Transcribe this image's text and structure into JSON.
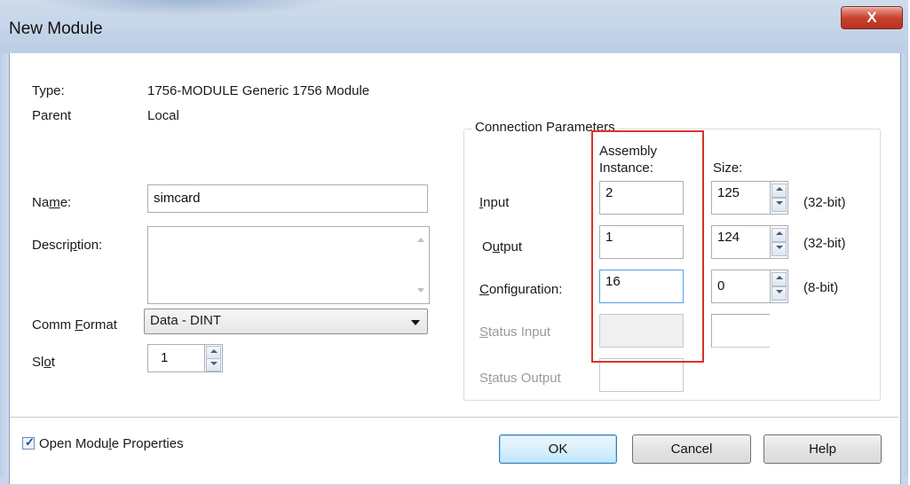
{
  "window": {
    "title": "New Module",
    "close_label": "X"
  },
  "module": {
    "type_label": "Type:",
    "type_value": "1756-MODULE Generic 1756 Module",
    "parent_label": "Parent",
    "parent_value": "Local",
    "name_label": "Name:",
    "name_value": "simcard",
    "description_label": "Description:",
    "description_value": "",
    "comm_format_label": "Comm Format",
    "comm_format_value": "Data - DINT",
    "slot_label": "Slot",
    "slot_value": "1"
  },
  "connection": {
    "group_title": "Connection Parameters",
    "col_instance_line1": "Assembly",
    "col_instance_line2": "Instance:",
    "col_size": "Size:",
    "rows": [
      {
        "label": "Input",
        "instance": "2",
        "size": "125",
        "unit": "(32-bit)",
        "enabled": true
      },
      {
        "label": "Output",
        "instance": "1",
        "size": "124",
        "unit": "(32-bit)",
        "enabled": true
      },
      {
        "label": "Configuration:",
        "instance": "16",
        "size": "0",
        "unit": "(8-bit)",
        "enabled": true
      },
      {
        "label": "Status Input",
        "instance": "",
        "size": "",
        "unit": "",
        "enabled": false
      },
      {
        "label": "Status Output",
        "instance": "",
        "size": "",
        "unit": "",
        "enabled": false
      }
    ]
  },
  "footer": {
    "open_props_label": "Open Module Properties",
    "open_props_checked": true,
    "ok_label": "OK",
    "cancel_label": "Cancel",
    "help_label": "Help"
  },
  "highlight_color": "#d9342b"
}
